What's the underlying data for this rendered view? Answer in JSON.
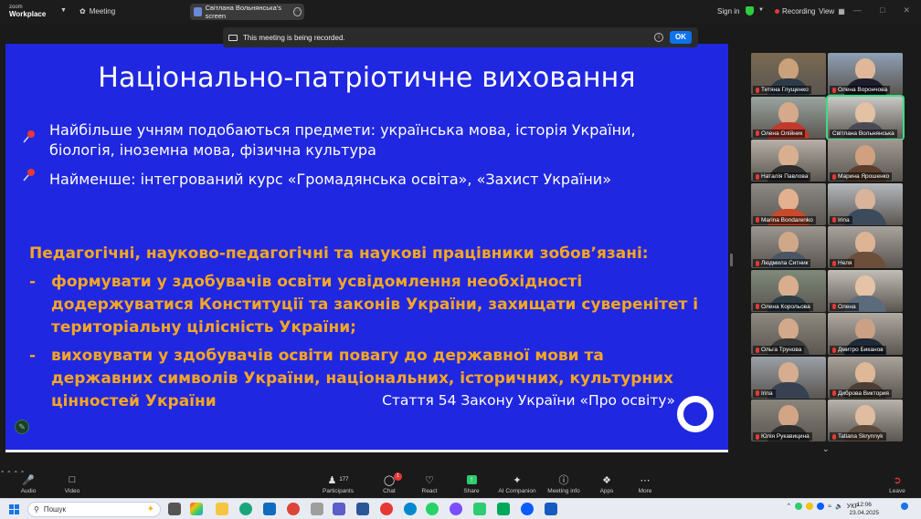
{
  "titlebar": {
    "logo_line1": "zoom",
    "logo_line2": "Workplace",
    "meeting_label": "Meeting",
    "screen_tab": "Світлана Вольнянська's screen",
    "sign_in": "Sign in",
    "recording": "Recording",
    "view": "View"
  },
  "banner": {
    "text": "This meeting is being recorded.",
    "ok": "OK"
  },
  "slide": {
    "title": "Національно-патріотичне виховання",
    "bullets": [
      "Найбільше учням подобаються предмети: українська мова, історія України, біологія, іноземна мова, фізична культура",
      "Найменше: інтегрований курс «Громадянська освіта», «Захист України»"
    ],
    "heading": "Педагогічні, науково-педагогічні та наукові працівники зобов’язані:",
    "duties": [
      "формувати у здобувачів освіти усвідомлення необхідності додержуватися Конституції та законів України, захищати суверенітет і територіальну цілісність України;",
      "виховувати у здобувачів освіти повагу до державної мови та державних символів України, національних, історичних, культурних цінностей України"
    ],
    "dash": "-",
    "citation": "Стаття 54 Закону України «Про освіту»"
  },
  "participants": [
    {
      "name": "Тетяна Глущенко",
      "muted": true
    },
    {
      "name": "Олена Ворончова",
      "muted": true
    },
    {
      "name": "Олена Олійник",
      "muted": true
    },
    {
      "name": "Світлана Вольнянська",
      "muted": false
    },
    {
      "name": "Наталія Павлова",
      "muted": true
    },
    {
      "name": "Марина Ярошенко",
      "muted": true
    },
    {
      "name": "Marina Bondarenko",
      "muted": true
    },
    {
      "name": "Irina",
      "muted": true
    },
    {
      "name": "Людмила Ситник",
      "muted": true
    },
    {
      "name": "Неля",
      "muted": true
    },
    {
      "name": "Олена Корольова",
      "muted": true
    },
    {
      "name": "Олена",
      "muted": true
    },
    {
      "name": "Ольга Трунова",
      "muted": true
    },
    {
      "name": "Дмитро Биканов",
      "muted": true
    },
    {
      "name": "Irina",
      "muted": true
    },
    {
      "name": "Диброва Виктория",
      "muted": true
    },
    {
      "name": "Юлія Рукавицина",
      "muted": true
    },
    {
      "name": "Tatiana Skrynnyk",
      "muted": true
    }
  ],
  "toolbar": {
    "audio": "Audio",
    "video": "Video",
    "participants": "Participants",
    "participants_count": "177",
    "chat": "Chat",
    "chat_badge": "1",
    "react": "React",
    "share": "Share",
    "ai_companion": "AI Companion",
    "meeting_info": "Meeting info",
    "apps": "Apps",
    "more": "More",
    "leave": "Leave"
  },
  "taskbar": {
    "search_placeholder": "Пошук",
    "language": "УКР",
    "time": "12:06",
    "date": "23.04.2025"
  },
  "colors": {
    "slide_bg": "#2027e0",
    "orange_text": "#f5a623",
    "record_red": "#e53935",
    "zoom_blue": "#0e72ed",
    "active_speaker": "#3ddc84"
  }
}
